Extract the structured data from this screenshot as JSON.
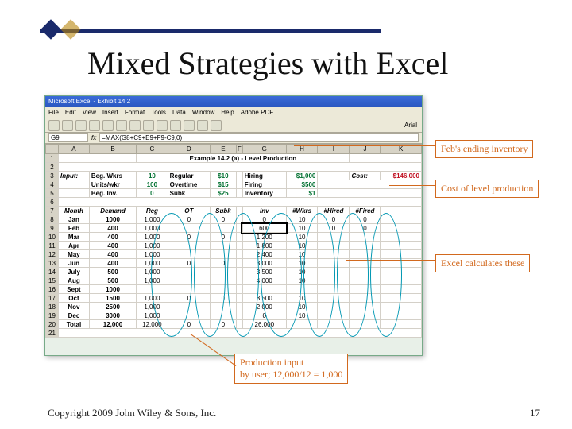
{
  "slide": {
    "title": "Mixed Strategies with Excel",
    "copyright": "Copyright 2009 John Wiley & Sons, Inc.",
    "pagenum": "17"
  },
  "excel": {
    "appTitle": "Microsoft Excel - Exhibit 14.2",
    "menu": [
      "File",
      "Edit",
      "View",
      "Insert",
      "Format",
      "Tools",
      "Data",
      "Window",
      "Help",
      "Adobe PDF"
    ],
    "font": "Arial",
    "namebox": "G9",
    "formula": "=MAX(G8+C9+E9+F9-C9,0)",
    "heading": "Example 14.2 (a) - Level Production",
    "cols": [
      "",
      "A",
      "B",
      "C",
      "D",
      "E",
      "F",
      "G",
      "H",
      "I",
      "J",
      "K"
    ],
    "input_labels": {
      "input": "Input:",
      "begwkrs": "Beg. Wkrs",
      "unitswkr": "Units/wkr",
      "beginv": "Beg. Inv.",
      "regular": "Regular",
      "overtime": "Overtime",
      "subk": "Subk",
      "hiring": "Hiring",
      "firing": "Firing",
      "inventory": "Inventory",
      "cost": "Cost:"
    },
    "input_vals": {
      "begwkrs": "10",
      "unitswkr": "100",
      "beginv": "0",
      "regular": "$10",
      "overtime": "$15",
      "subk": "$25",
      "hiring": "$1,000",
      "firing": "$500",
      "inventory": "$1",
      "costval": "$146,000"
    },
    "tbl_hdrs": {
      "month": "Month",
      "demand": "Demand",
      "reg": "Reg",
      "ot": "OT",
      "subk": "Subk",
      "inv": "Inv",
      "wkrs": "#Wkrs",
      "hired": "#Hired",
      "fired": "#Fired"
    },
    "rows": [
      {
        "n": "8",
        "month": "Jan",
        "demand": "1000",
        "reg": "1,000",
        "ot": "0",
        "subk": "0",
        "inv": "0",
        "wkrs": "10",
        "hired": "0",
        "fired": "0"
      },
      {
        "n": "9",
        "month": "Feb",
        "demand": "400",
        "reg": "1,000",
        "ot": "",
        "subk": "",
        "inv": "600",
        "wkrs": "10",
        "hired": "0",
        "fired": "0"
      },
      {
        "n": "10",
        "month": "Mar",
        "demand": "400",
        "reg": "1,000",
        "ot": "0",
        "subk": "0",
        "inv": "1,200",
        "wkrs": "10",
        "hired": "",
        "fired": ""
      },
      {
        "n": "11",
        "month": "Apr",
        "demand": "400",
        "reg": "1,000",
        "ot": "",
        "subk": "",
        "inv": "1,800",
        "wkrs": "10",
        "hired": "",
        "fired": ""
      },
      {
        "n": "12",
        "month": "May",
        "demand": "400",
        "reg": "1,000",
        "ot": "",
        "subk": "",
        "inv": "2,400",
        "wkrs": "10",
        "hired": "",
        "fired": ""
      },
      {
        "n": "13",
        "month": "Jun",
        "demand": "400",
        "reg": "1,000",
        "ot": "0",
        "subk": "0",
        "inv": "3,000",
        "wkrs": "10",
        "hired": "",
        "fired": ""
      },
      {
        "n": "14",
        "month": "July",
        "demand": "500",
        "reg": "1,000",
        "ot": "",
        "subk": "",
        "inv": "3,500",
        "wkrs": "10",
        "hired": "",
        "fired": ""
      },
      {
        "n": "15",
        "month": "Aug",
        "demand": "500",
        "reg": "1,000",
        "ot": "",
        "subk": "",
        "inv": "4,000",
        "wkrs": "10",
        "hired": "",
        "fired": ""
      },
      {
        "n": "16",
        "month": "Sept",
        "demand": "1000",
        "reg": "",
        "ot": "",
        "subk": "",
        "inv": "",
        "wkrs": "",
        "hired": "",
        "fired": ""
      },
      {
        "n": "17",
        "month": "Oct",
        "demand": "1500",
        "reg": "1,000",
        "ot": "0",
        "subk": "0",
        "inv": "3,500",
        "wkrs": "10",
        "hired": "",
        "fired": ""
      },
      {
        "n": "18",
        "month": "Nov",
        "demand": "2500",
        "reg": "1,000",
        "ot": "",
        "subk": "",
        "inv": "2,000",
        "wkrs": "10",
        "hired": "",
        "fired": ""
      },
      {
        "n": "19",
        "month": "Dec",
        "demand": "3000",
        "reg": "1,000",
        "ot": "",
        "subk": "",
        "inv": "0",
        "wkrs": "10",
        "hired": "",
        "fired": ""
      },
      {
        "n": "20",
        "month": "Total",
        "demand": "12,000",
        "reg": "12,000",
        "ot": "0",
        "subk": "0",
        "inv": "26,000",
        "wkrs": "",
        "hired": "",
        "fired": ""
      }
    ],
    "row21": "21"
  },
  "callouts": {
    "c1": "Feb's ending inventory",
    "c2": "Cost of level production",
    "c3": "Excel calculates these",
    "c4": "Production input\nby user; 12,000/12 = 1,000"
  }
}
